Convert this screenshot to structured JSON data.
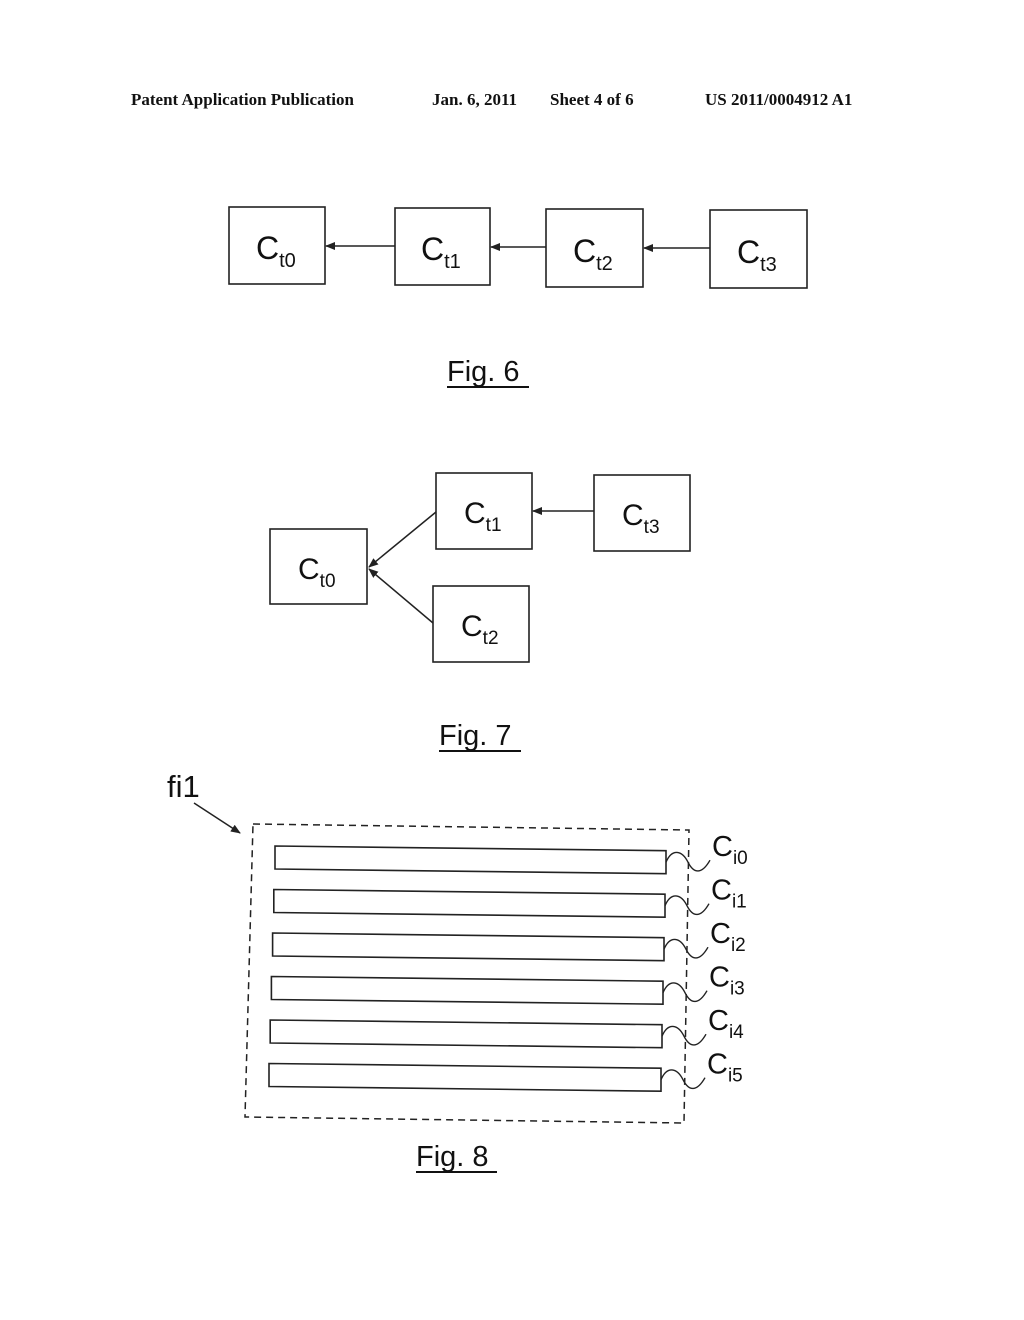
{
  "header": {
    "publication": "Patent Application Publication",
    "date": "Jan. 6, 2011",
    "sheet": "Sheet 4 of 6",
    "number": "US 2011/0004912 A1"
  },
  "fig6": {
    "caption": "Fig. 6",
    "nodes": [
      {
        "main": "C",
        "sub": "t0"
      },
      {
        "main": "C",
        "sub": "t1"
      },
      {
        "main": "C",
        "sub": "t2"
      },
      {
        "main": "C",
        "sub": "t3"
      }
    ],
    "edges": [
      {
        "from": "Ct1",
        "to": "Ct0"
      },
      {
        "from": "Ct2",
        "to": "Ct1"
      },
      {
        "from": "Ct3",
        "to": "Ct2"
      }
    ]
  },
  "fig7": {
    "caption": "Fig. 7",
    "nodes": [
      {
        "main": "C",
        "sub": "t0"
      },
      {
        "main": "C",
        "sub": "t1"
      },
      {
        "main": "C",
        "sub": "t2"
      },
      {
        "main": "C",
        "sub": "t3"
      }
    ],
    "edges": [
      {
        "from": "Ct1",
        "to": "Ct0"
      },
      {
        "from": "Ct2",
        "to": "Ct0"
      },
      {
        "from": "Ct3",
        "to": "Ct1"
      }
    ]
  },
  "fig8": {
    "caption": "Fig. 8",
    "frame_label": "fi1",
    "bars": [
      {
        "main": "C",
        "sub": "i0"
      },
      {
        "main": "C",
        "sub": "i1"
      },
      {
        "main": "C",
        "sub": "i2"
      },
      {
        "main": "C",
        "sub": "i3"
      },
      {
        "main": "C",
        "sub": "i4"
      },
      {
        "main": "C",
        "sub": "i5"
      }
    ]
  }
}
